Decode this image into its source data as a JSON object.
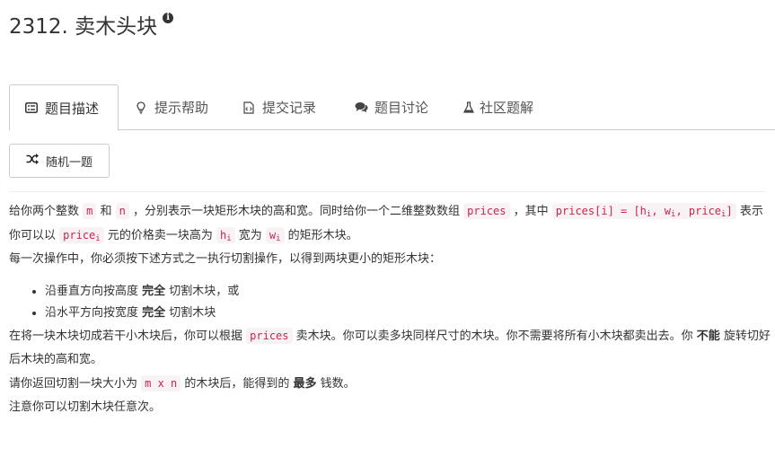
{
  "title": "2312. 卖木头块",
  "tabs": [
    {
      "label": "题目描述"
    },
    {
      "label": "提示帮助"
    },
    {
      "label": "提交记录"
    },
    {
      "label": "题目讨论"
    },
    {
      "label": "社区题解"
    }
  ],
  "random_button": "随机一题",
  "description": {
    "p1": {
      "t1": "给你两个整数 ",
      "c1": "m",
      "t2": " 和 ",
      "c2": "n",
      "t3": " ，分别表示一块矩形木块的高和宽。同时给你一个二维整数数组 ",
      "c3": "prices",
      "t4": " ，其中 ",
      "c4a": "prices[i] = [h",
      "c4s1": "i",
      "c4b": ", w",
      "c4s2": "i",
      "c4c": ", price",
      "c4s3": "i",
      "c4d": "]",
      "t5": " 表示你可以以 ",
      "c5": "price",
      "c5s": "i",
      "t6": " 元的价格卖一块高为 ",
      "c6": "h",
      "c6s": "i",
      "t7": " 宽为 ",
      "c7": "w",
      "c7s": "i",
      "t8": " 的矩形木块。"
    },
    "p2": "每一次操作中，你必须按下述方式之一执行切割操作，以得到两块更小的矩形木块：",
    "bullet1": {
      "a": "沿垂直方向按高度 ",
      "b": "完全",
      "c": " 切割木块，或"
    },
    "bullet2": {
      "a": "沿水平方向按宽度 ",
      "b": "完全",
      "c": " 切割木块"
    },
    "p3": {
      "t1": "在将一块木块切成若干小木块后，你可以根据 ",
      "c1": "prices",
      "t2": " 卖木块。你可以卖多块同样尺寸的木块。你不需要将所有小木块都卖出去。你 ",
      "b1": "不能",
      "t3": " 旋转切好后木块的高和宽。"
    },
    "p4": {
      "t1": "请你返回切割一块大小为 ",
      "c1": "m x n",
      "t2": " 的木块后，能得到的 ",
      "b1": "最多",
      "t3": " 钱数。"
    },
    "p5": "注意你可以切割木块任意次。"
  }
}
